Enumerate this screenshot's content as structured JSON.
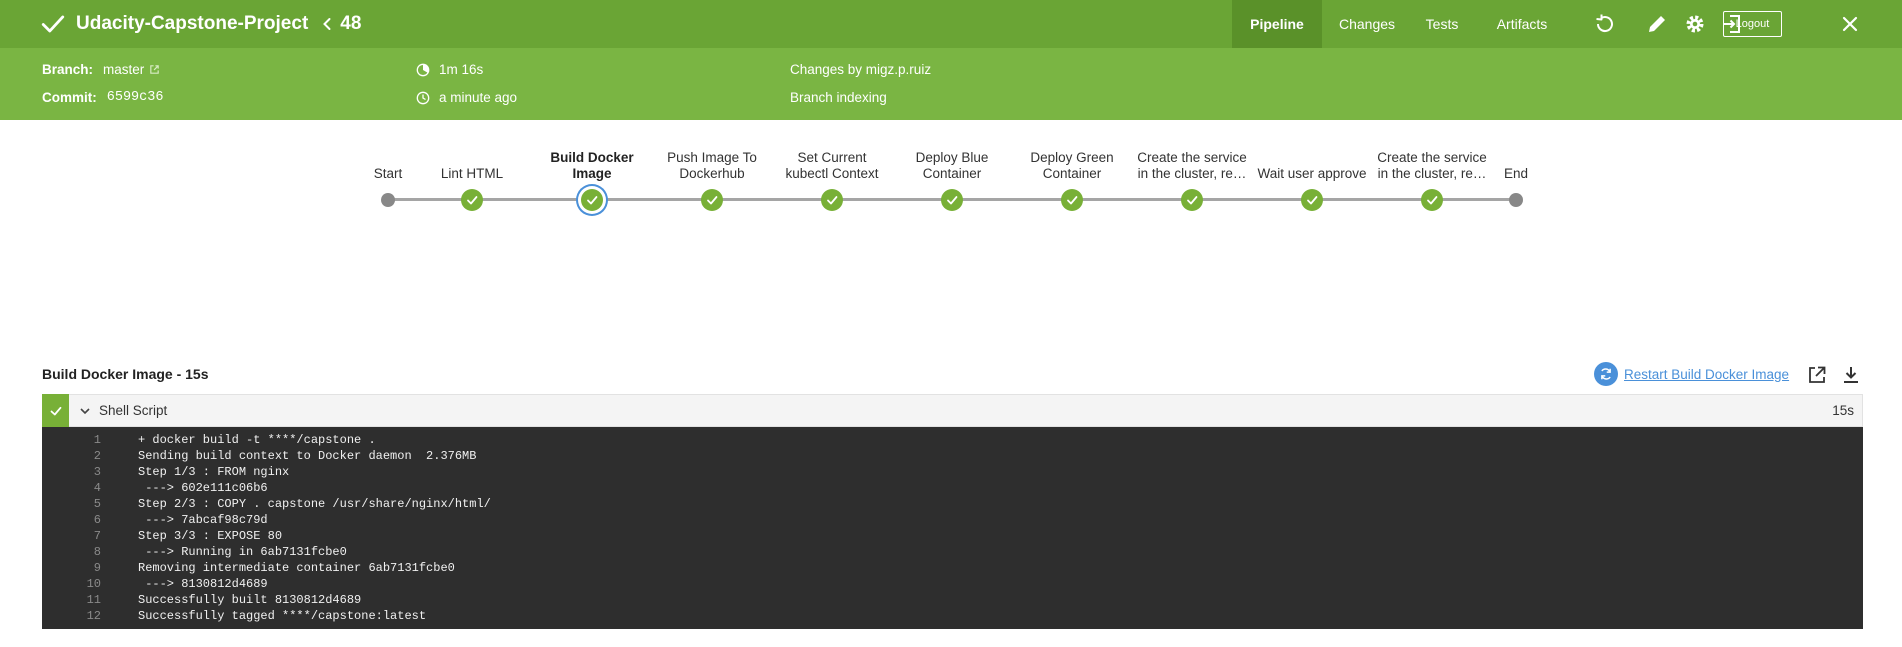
{
  "header": {
    "title": "Udacity-Capstone-Project",
    "run_number": "48",
    "tabs": [
      "Pipeline",
      "Changes",
      "Tests",
      "Artifacts"
    ],
    "active_tab": "Pipeline",
    "logout_label": "Logout"
  },
  "info": {
    "branch_label": "Branch:",
    "branch_value": "master",
    "commit_label": "Commit:",
    "commit_value": "6599c36",
    "duration": "1m 16s",
    "started": "a minute ago",
    "changes": "Changes by migz.p.ruiz",
    "cause": "Branch indexing"
  },
  "stages": [
    {
      "label": "Start",
      "status": "start"
    },
    {
      "label": "Lint HTML",
      "status": "success"
    },
    {
      "label": "Build Docker Image",
      "status": "success",
      "selected": true
    },
    {
      "label": "Push Image To Dockerhub",
      "status": "success"
    },
    {
      "label": "Set Current kubectl Context",
      "status": "success"
    },
    {
      "label": "Deploy Blue Container",
      "status": "success"
    },
    {
      "label": "Deploy Green Container",
      "status": "success"
    },
    {
      "label": "Create the service in the cluster, re…",
      "status": "success"
    },
    {
      "label": "Wait user approve",
      "status": "success"
    },
    {
      "label": "Create the service in the cluster, re…",
      "status": "success"
    },
    {
      "label": "End",
      "status": "end"
    }
  ],
  "step_panel": {
    "heading": "Build Docker Image - 15s",
    "restart_label": "Restart Build Docker Image",
    "step_name": "Shell Script",
    "step_duration": "15s"
  },
  "log": [
    {
      "n": "1",
      "text": "+ docker build -t ****/capstone ."
    },
    {
      "n": "2",
      "text": "Sending build context to Docker daemon  2.376MB"
    },
    {
      "n": "3",
      "text": "Step 1/3 : FROM nginx"
    },
    {
      "n": "4",
      "text": " ---> 602e111c06b6"
    },
    {
      "n": "5",
      "text": "Step 2/3 : COPY . capstone /usr/share/nginx/html/"
    },
    {
      "n": "6",
      "text": " ---> 7abcaf98c79d"
    },
    {
      "n": "7",
      "text": "Step 3/3 : EXPOSE 80"
    },
    {
      "n": "8",
      "text": " ---> Running in 6ab7131fcbe0"
    },
    {
      "n": "9",
      "text": "Removing intermediate container 6ab7131fcbe0"
    },
    {
      "n": "10",
      "text": " ---> 8130812d4689"
    },
    {
      "n": "11",
      "text": "Successfully built 8130812d4689"
    },
    {
      "n": "12",
      "text": "Successfully tagged ****/capstone:latest"
    }
  ],
  "colors": {
    "topbar": "#6aa535",
    "infobar": "#7ab543",
    "success": "#78b037",
    "selected_ring": "#4a90d9",
    "console_bg": "#2e2e2e"
  },
  "icons": [
    "check-icon",
    "chevron-left-icon",
    "replay-icon",
    "pencil-icon",
    "gear-icon",
    "exit-icon",
    "close-icon",
    "external-link-icon",
    "timer-icon",
    "clock-icon",
    "restart-icon",
    "open-new-window-icon",
    "download-icon",
    "chevron-down-icon"
  ]
}
